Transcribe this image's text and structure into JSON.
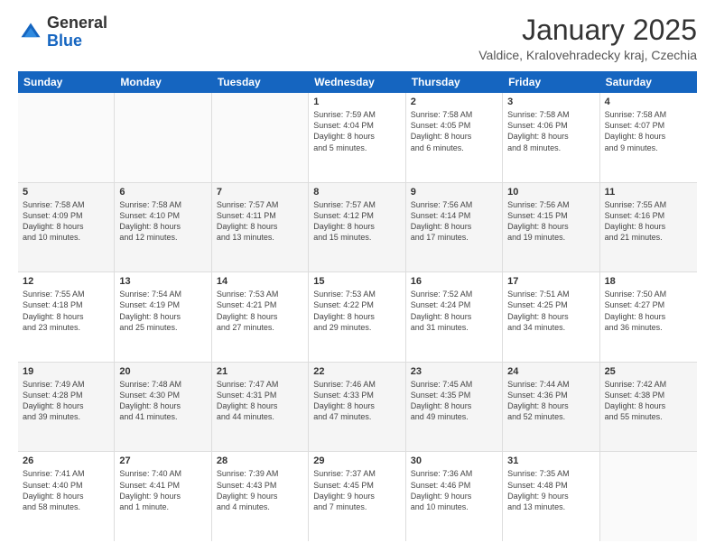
{
  "logo": {
    "general": "General",
    "blue": "Blue"
  },
  "title": "January 2025",
  "location": "Valdice, Kralovehradecky kraj, Czechia",
  "days": [
    "Sunday",
    "Monday",
    "Tuesday",
    "Wednesday",
    "Thursday",
    "Friday",
    "Saturday"
  ],
  "rows": [
    [
      {
        "num": "",
        "lines": []
      },
      {
        "num": "",
        "lines": []
      },
      {
        "num": "",
        "lines": []
      },
      {
        "num": "1",
        "lines": [
          "Sunrise: 7:59 AM",
          "Sunset: 4:04 PM",
          "Daylight: 8 hours",
          "and 5 minutes."
        ]
      },
      {
        "num": "2",
        "lines": [
          "Sunrise: 7:58 AM",
          "Sunset: 4:05 PM",
          "Daylight: 8 hours",
          "and 6 minutes."
        ]
      },
      {
        "num": "3",
        "lines": [
          "Sunrise: 7:58 AM",
          "Sunset: 4:06 PM",
          "Daylight: 8 hours",
          "and 8 minutes."
        ]
      },
      {
        "num": "4",
        "lines": [
          "Sunrise: 7:58 AM",
          "Sunset: 4:07 PM",
          "Daylight: 8 hours",
          "and 9 minutes."
        ]
      }
    ],
    [
      {
        "num": "5",
        "lines": [
          "Sunrise: 7:58 AM",
          "Sunset: 4:09 PM",
          "Daylight: 8 hours",
          "and 10 minutes."
        ]
      },
      {
        "num": "6",
        "lines": [
          "Sunrise: 7:58 AM",
          "Sunset: 4:10 PM",
          "Daylight: 8 hours",
          "and 12 minutes."
        ]
      },
      {
        "num": "7",
        "lines": [
          "Sunrise: 7:57 AM",
          "Sunset: 4:11 PM",
          "Daylight: 8 hours",
          "and 13 minutes."
        ]
      },
      {
        "num": "8",
        "lines": [
          "Sunrise: 7:57 AM",
          "Sunset: 4:12 PM",
          "Daylight: 8 hours",
          "and 15 minutes."
        ]
      },
      {
        "num": "9",
        "lines": [
          "Sunrise: 7:56 AM",
          "Sunset: 4:14 PM",
          "Daylight: 8 hours",
          "and 17 minutes."
        ]
      },
      {
        "num": "10",
        "lines": [
          "Sunrise: 7:56 AM",
          "Sunset: 4:15 PM",
          "Daylight: 8 hours",
          "and 19 minutes."
        ]
      },
      {
        "num": "11",
        "lines": [
          "Sunrise: 7:55 AM",
          "Sunset: 4:16 PM",
          "Daylight: 8 hours",
          "and 21 minutes."
        ]
      }
    ],
    [
      {
        "num": "12",
        "lines": [
          "Sunrise: 7:55 AM",
          "Sunset: 4:18 PM",
          "Daylight: 8 hours",
          "and 23 minutes."
        ]
      },
      {
        "num": "13",
        "lines": [
          "Sunrise: 7:54 AM",
          "Sunset: 4:19 PM",
          "Daylight: 8 hours",
          "and 25 minutes."
        ]
      },
      {
        "num": "14",
        "lines": [
          "Sunrise: 7:53 AM",
          "Sunset: 4:21 PM",
          "Daylight: 8 hours",
          "and 27 minutes."
        ]
      },
      {
        "num": "15",
        "lines": [
          "Sunrise: 7:53 AM",
          "Sunset: 4:22 PM",
          "Daylight: 8 hours",
          "and 29 minutes."
        ]
      },
      {
        "num": "16",
        "lines": [
          "Sunrise: 7:52 AM",
          "Sunset: 4:24 PM",
          "Daylight: 8 hours",
          "and 31 minutes."
        ]
      },
      {
        "num": "17",
        "lines": [
          "Sunrise: 7:51 AM",
          "Sunset: 4:25 PM",
          "Daylight: 8 hours",
          "and 34 minutes."
        ]
      },
      {
        "num": "18",
        "lines": [
          "Sunrise: 7:50 AM",
          "Sunset: 4:27 PM",
          "Daylight: 8 hours",
          "and 36 minutes."
        ]
      }
    ],
    [
      {
        "num": "19",
        "lines": [
          "Sunrise: 7:49 AM",
          "Sunset: 4:28 PM",
          "Daylight: 8 hours",
          "and 39 minutes."
        ]
      },
      {
        "num": "20",
        "lines": [
          "Sunrise: 7:48 AM",
          "Sunset: 4:30 PM",
          "Daylight: 8 hours",
          "and 41 minutes."
        ]
      },
      {
        "num": "21",
        "lines": [
          "Sunrise: 7:47 AM",
          "Sunset: 4:31 PM",
          "Daylight: 8 hours",
          "and 44 minutes."
        ]
      },
      {
        "num": "22",
        "lines": [
          "Sunrise: 7:46 AM",
          "Sunset: 4:33 PM",
          "Daylight: 8 hours",
          "and 47 minutes."
        ]
      },
      {
        "num": "23",
        "lines": [
          "Sunrise: 7:45 AM",
          "Sunset: 4:35 PM",
          "Daylight: 8 hours",
          "and 49 minutes."
        ]
      },
      {
        "num": "24",
        "lines": [
          "Sunrise: 7:44 AM",
          "Sunset: 4:36 PM",
          "Daylight: 8 hours",
          "and 52 minutes."
        ]
      },
      {
        "num": "25",
        "lines": [
          "Sunrise: 7:42 AM",
          "Sunset: 4:38 PM",
          "Daylight: 8 hours",
          "and 55 minutes."
        ]
      }
    ],
    [
      {
        "num": "26",
        "lines": [
          "Sunrise: 7:41 AM",
          "Sunset: 4:40 PM",
          "Daylight: 8 hours",
          "and 58 minutes."
        ]
      },
      {
        "num": "27",
        "lines": [
          "Sunrise: 7:40 AM",
          "Sunset: 4:41 PM",
          "Daylight: 9 hours",
          "and 1 minute."
        ]
      },
      {
        "num": "28",
        "lines": [
          "Sunrise: 7:39 AM",
          "Sunset: 4:43 PM",
          "Daylight: 9 hours",
          "and 4 minutes."
        ]
      },
      {
        "num": "29",
        "lines": [
          "Sunrise: 7:37 AM",
          "Sunset: 4:45 PM",
          "Daylight: 9 hours",
          "and 7 minutes."
        ]
      },
      {
        "num": "30",
        "lines": [
          "Sunrise: 7:36 AM",
          "Sunset: 4:46 PM",
          "Daylight: 9 hours",
          "and 10 minutes."
        ]
      },
      {
        "num": "31",
        "lines": [
          "Sunrise: 7:35 AM",
          "Sunset: 4:48 PM",
          "Daylight: 9 hours",
          "and 13 minutes."
        ]
      },
      {
        "num": "",
        "lines": []
      }
    ]
  ]
}
